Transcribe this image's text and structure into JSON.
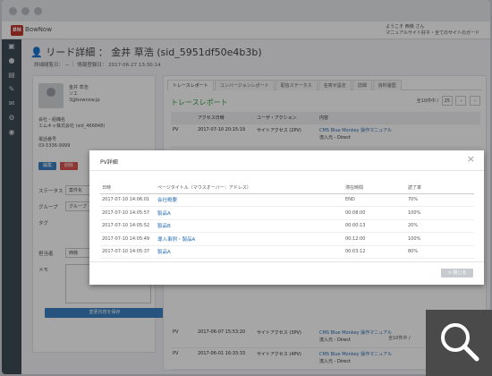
{
  "header": {
    "logo_mark": "BN",
    "logo_text": "BowNow",
    "user_line1": "ようこそ 西條 さん",
    "user_line2": "マニュアルサイト好ネ・全てのサイトのガード"
  },
  "page": {
    "title": "リード詳細 ： 金井 草浩 (sid_5951df50e4b3b)",
    "meta": "詳細閲覧日： − ｜ 情報登録日： 2017-06-27 13:30:14"
  },
  "lead": {
    "name": "金井 草浩",
    "name_sub": "ソエ",
    "email": "3@bownow.jp",
    "company_label": "会社・組織名",
    "company": "エムキャ株式会社 (sid_466848)",
    "phone_label": "電話番号",
    "phone": "03-5336-9999",
    "btn_edit": "編集",
    "btn_delete": "削除",
    "status_label": "ステータス",
    "status_value": "案件化",
    "group_label": "グループ",
    "group_value": "グループ",
    "tag_label": "タグ",
    "owner_label": "担当者",
    "owner_value": "西條",
    "memo_label": "メモ",
    "save_button": "変更内容を保存"
  },
  "tabs": [
    "トレースレポート",
    "コンバージョンレポート",
    "配信ステータス",
    "名寄せ設定",
    "詳細",
    "資料履歴"
  ],
  "report": {
    "title": "トレースレポート",
    "pager_text": "全10件中 /",
    "pager_select": "25",
    "footer_pager": "全10件中 /",
    "columns": [
      "アクセス日時",
      "ユーザ・アクション",
      "内容"
    ],
    "rows": [
      {
        "type": "PV",
        "date": "2017-07-10 20:15:19",
        "action": "サイトアクセス (2PV)",
        "content": "CMS Blue Monkey 操作マニュアル",
        "source": "流入元 - Direct"
      },
      {
        "type": "PV",
        "date": "2017-06-07 15:53:20",
        "action": "サイトアクセス (3PV)",
        "content": "CMS Blue Monkey 操作マニュアル",
        "source": "流入元 - Direct"
      },
      {
        "type": "PV",
        "date": "2017-06-01 16:33:33",
        "action": "サイトアクセス (4PV)",
        "content": "CMS Blue Monkey 操作マニュアル",
        "source": "流入元 - Direct"
      }
    ]
  },
  "modal": {
    "title": "PV詳細",
    "close_label": "閉じる",
    "columns": [
      "日時",
      "ページタイトル（マウスオーバー：アドレス）",
      "滞在時間",
      "読了率"
    ],
    "rows": [
      {
        "date": "2017-07-10 14:06:01",
        "page": "会社概要",
        "time": "END",
        "rate": "70%"
      },
      {
        "date": "2017-07-10 14:05:57",
        "page": "製品A",
        "time": "00:08:00",
        "rate": "100%"
      },
      {
        "date": "2017-07-10 14:05:52",
        "page": "製品B",
        "time": "00:00:13",
        "rate": "20%"
      },
      {
        "date": "2017-07-10 14:05:49",
        "page": "導入事例・製品A",
        "time": "00:12:00",
        "rate": "100%"
      },
      {
        "date": "2017-07-10 14:05:37",
        "page": "製品A",
        "time": "00:03:12",
        "rate": "80%"
      }
    ]
  },
  "colors": {
    "brand_red": "#c0392b",
    "accent_green": "#3aa34a",
    "link_blue": "#2a6fb5",
    "sidebar": "#3e4a57",
    "button_blue": "#3c82c4"
  },
  "icons": [
    "dashboard-icon",
    "user-icon",
    "document-icon",
    "edit-icon",
    "mail-icon",
    "settings-icon",
    "search-icon"
  ]
}
